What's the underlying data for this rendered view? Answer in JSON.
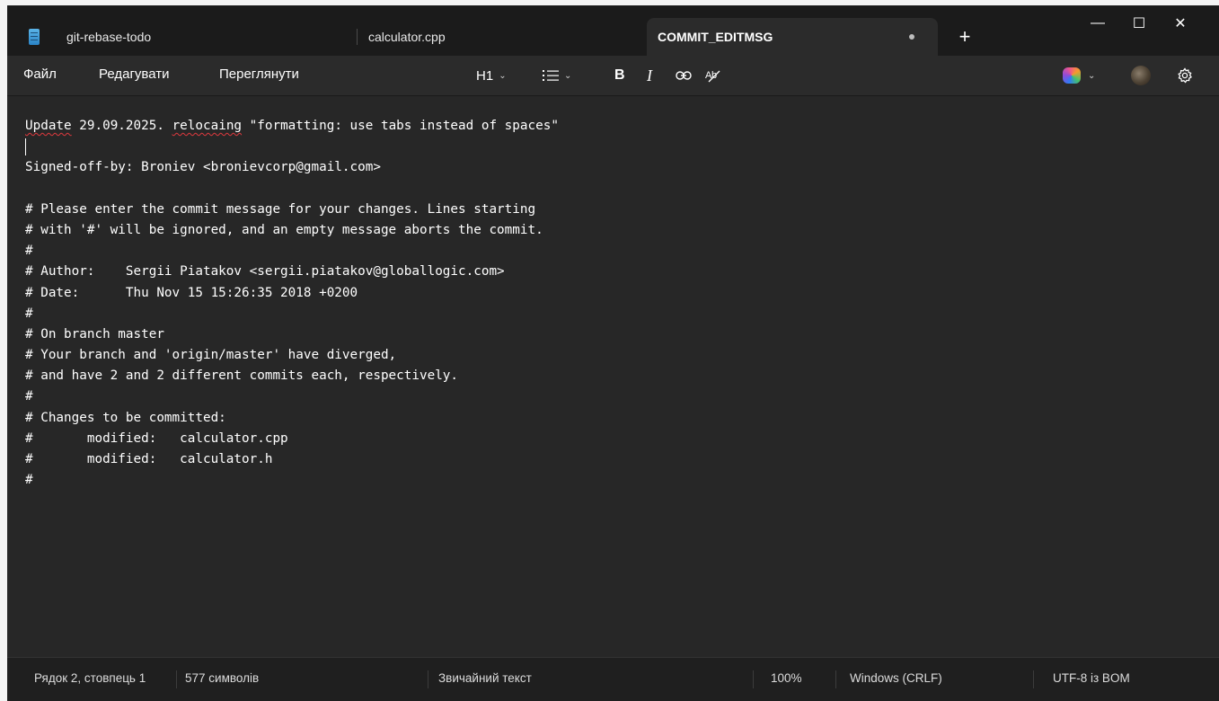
{
  "tabs": [
    {
      "label": "git-rebase-todo",
      "icon": "notepad-icon"
    },
    {
      "label": "calculator.cpp"
    },
    {
      "label": "COMMIT_EDITMSG",
      "active": true,
      "modified": true
    }
  ],
  "window_controls": {
    "new_tab": "+",
    "minimize": "—",
    "maximize": "☐",
    "close": "✕"
  },
  "menu": [
    "Файл",
    "Редагувати",
    "Переглянути"
  ],
  "toolbar": {
    "heading": "H1",
    "list_icon": "list-icon",
    "bold": "B",
    "italic": "I",
    "link_icon": "link-icon",
    "clear_format_icon": "clear-formatting-icon",
    "settings_icon": "gear-icon"
  },
  "editor": {
    "lines": [
      "Update 29.09.2025. relocaing \"formatting: use tabs instead of spaces\"",
      "",
      "Signed-off-by: Broniev <bronievcorp@gmail.com>",
      "",
      "# Please enter the commit message for your changes. Lines starting",
      "# with '#' will be ignored, and an empty message aborts the commit.",
      "#",
      "# Author:    Sergii Piatakov <sergii.piatakov@globallogic.com>",
      "# Date:      Thu Nov 15 15:26:35 2018 +0200",
      "#",
      "# On branch master",
      "# Your branch and 'origin/master' have diverged,",
      "# and have 2 and 2 different commits each, respectively.",
      "#",
      "# Changes to be committed:",
      "#       modified:   calculator.cpp",
      "#       modified:   calculator.h",
      "#"
    ]
  },
  "status": {
    "position": "Рядок 2, стовпець 1",
    "chars": "577 символів",
    "format": "Звичайний текст",
    "zoom": "100%",
    "line_ending": "Windows (CRLF)",
    "encoding": "UTF-8 із BOM"
  },
  "colors": {
    "background": "#202020",
    "editor": "#272727",
    "spellcheck": "#e0393e"
  }
}
